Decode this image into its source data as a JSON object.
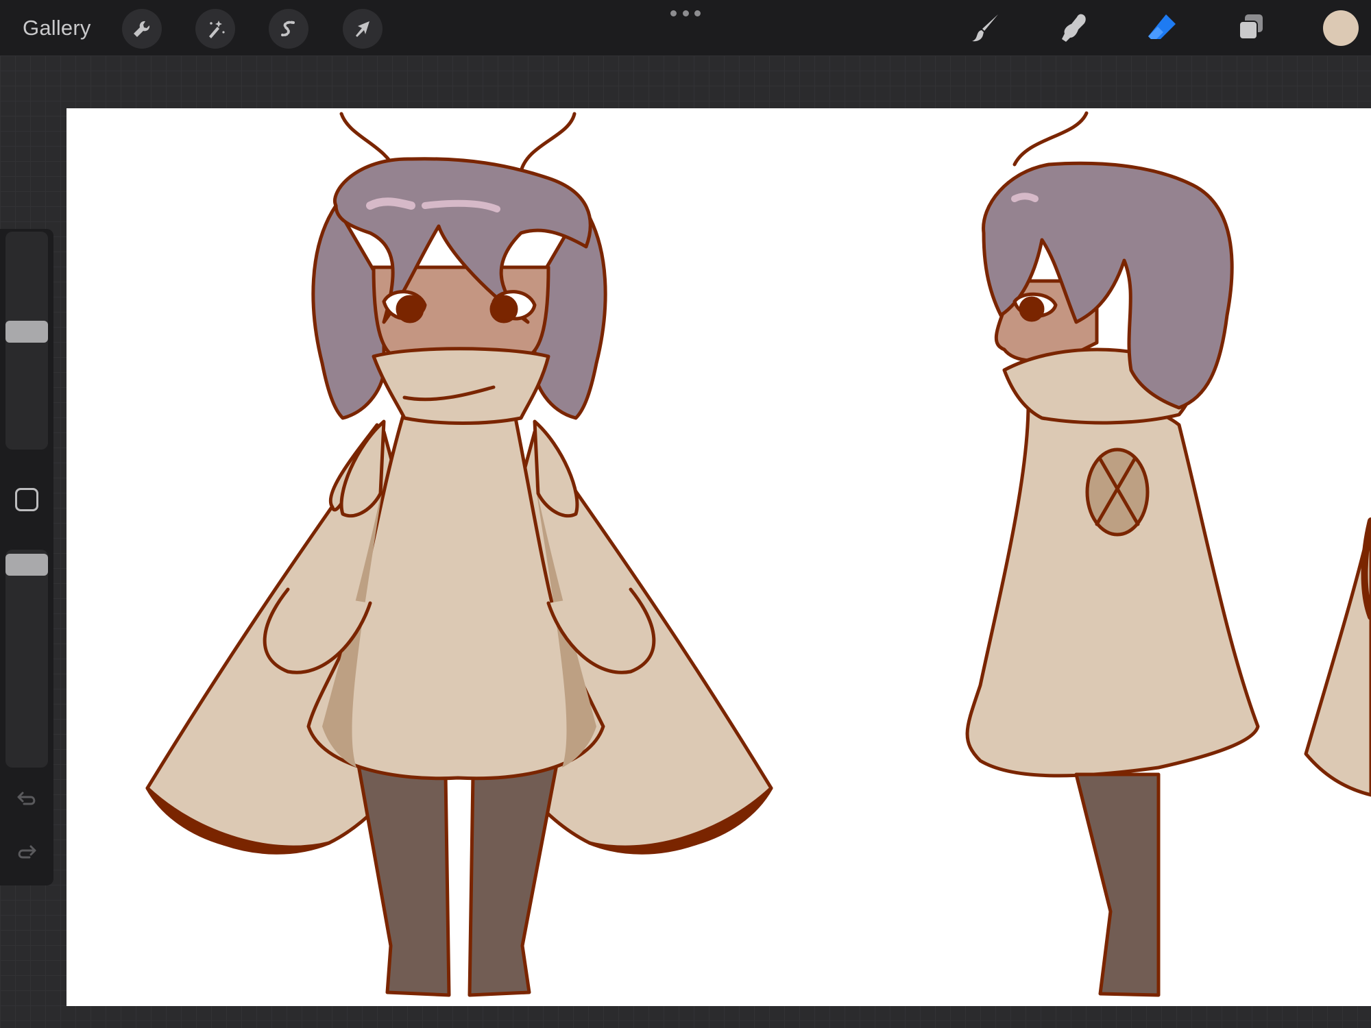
{
  "topbar": {
    "gallery_label": "Gallery",
    "left_tools": [
      {
        "name": "actions",
        "icon": "wrench-icon"
      },
      {
        "name": "adjustments",
        "icon": "magic-wand-icon"
      },
      {
        "name": "selection",
        "icon": "selection-s-icon"
      },
      {
        "name": "transform",
        "icon": "arrow-cursor-icon"
      }
    ],
    "right_tools": [
      {
        "name": "brush",
        "icon": "brush-icon",
        "active": false
      },
      {
        "name": "smudge",
        "icon": "smudge-finger-icon",
        "active": false
      },
      {
        "name": "eraser",
        "icon": "eraser-icon",
        "active": true
      },
      {
        "name": "layers",
        "icon": "layers-icon",
        "active": false
      }
    ],
    "current_color": "#dcc9b4",
    "active_tool_color": "#1e7bf2"
  },
  "sidebar": {
    "brush_size_level": 0.48,
    "opacity_level": 0.95,
    "modify_icon": "square-outline-icon",
    "undo_icon": "undo-arrow-icon",
    "redo_icon": "redo-arrow-icon"
  },
  "canvas": {
    "background": "#ffffff",
    "artwork": "moth-character-turnaround",
    "palette": {
      "outline": "#7a2500",
      "hair": "#958390",
      "hair_shadow": "#6c5866",
      "skin": "#c49682",
      "cloak": "#dcc9b4",
      "cloak_shadow": "#bda083",
      "legs": "#725d54"
    }
  }
}
